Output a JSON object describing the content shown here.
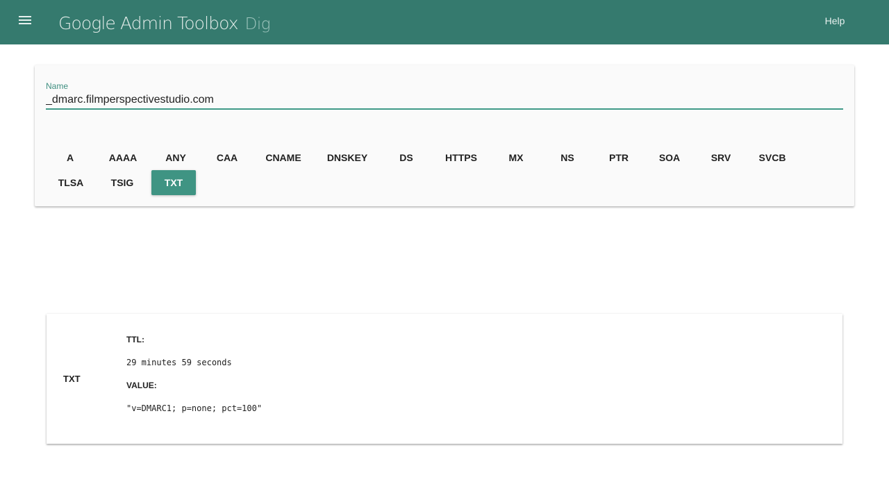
{
  "header": {
    "title": "Google Admin Toolbox",
    "subtitle": "Dig",
    "help_label": "Help",
    "menu_icon": "menu-icon",
    "background_color": "#357a6e"
  },
  "query": {
    "name_label": "Name",
    "name_value": "_dmarc.filmperspectivestudio.com",
    "record_types": [
      "A",
      "AAAA",
      "ANY",
      "CAA",
      "CNAME",
      "DNSKEY",
      "DS",
      "HTTPS",
      "MX",
      "NS",
      "PTR",
      "SOA",
      "SRV",
      "SVCB",
      "TLSA",
      "TSIG",
      "TXT"
    ],
    "selected_type": "TXT",
    "accent_color": "#3f9483"
  },
  "result": {
    "type": "TXT",
    "ttl_label": "TTL:",
    "ttl_value": "29 minutes 59 seconds",
    "value_label": "VALUE:",
    "value_value": "\"v=DMARC1; p=none; pct=100\""
  }
}
